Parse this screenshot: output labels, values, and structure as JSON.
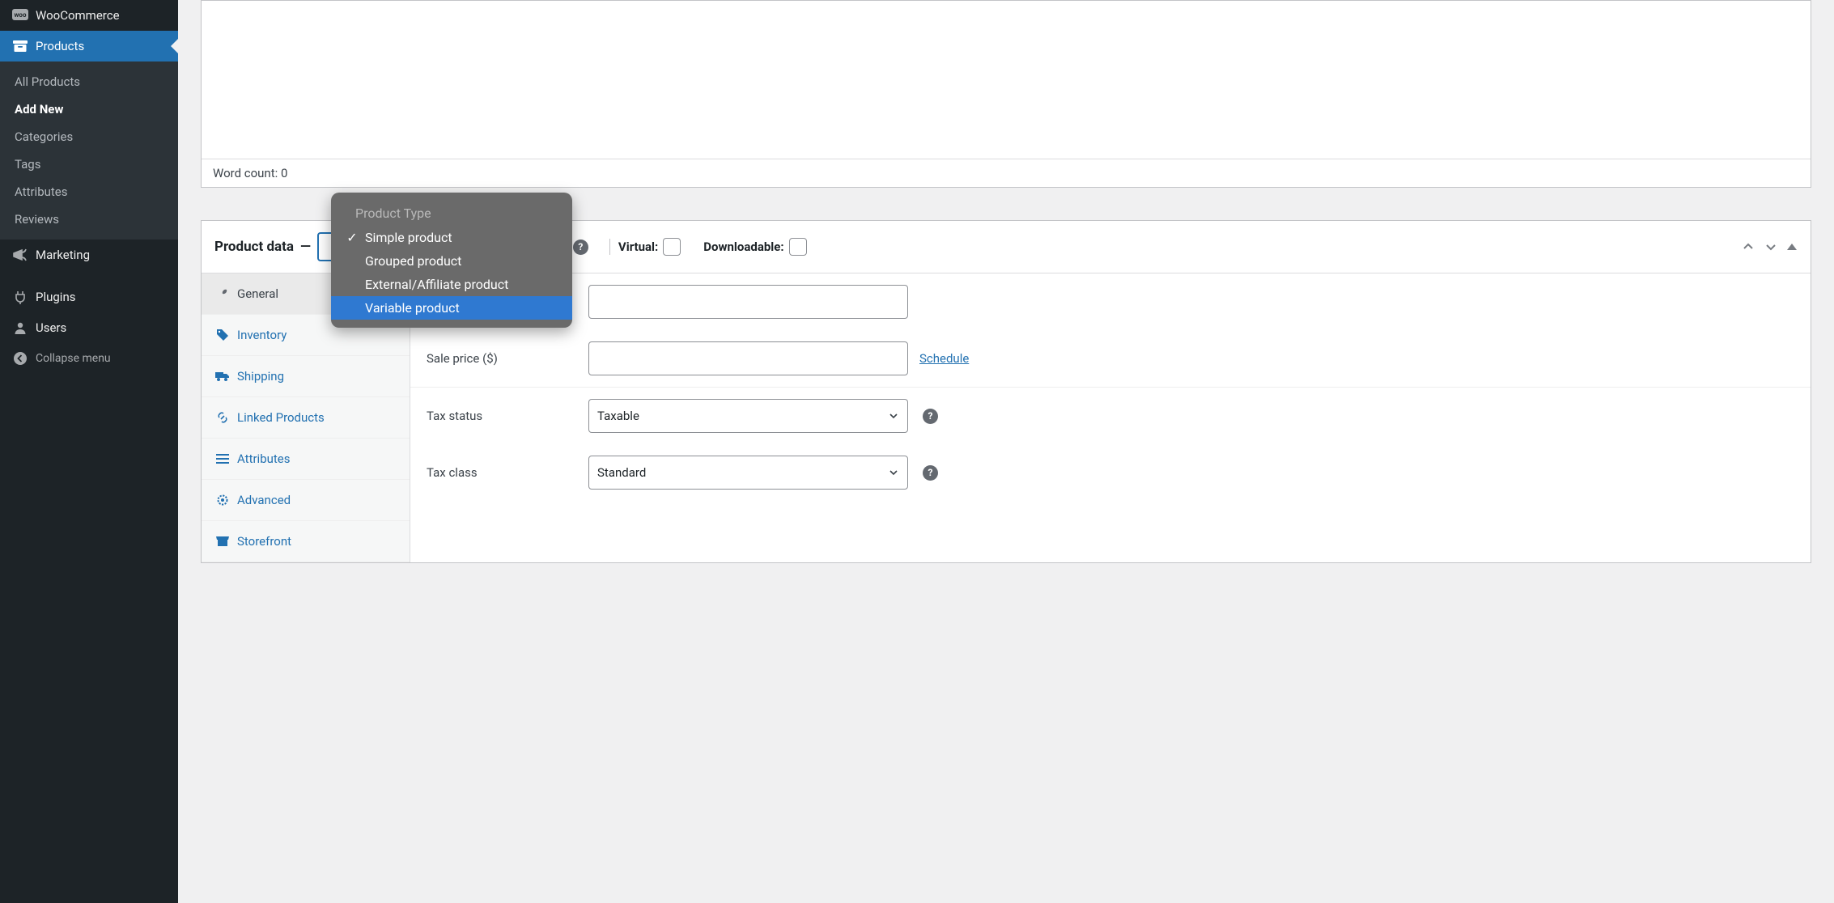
{
  "sidebar": {
    "woocommerce_label": "WooCommerce",
    "products_label": "Products",
    "submenu": [
      {
        "label": "All Products",
        "current": false
      },
      {
        "label": "Add New",
        "current": true
      },
      {
        "label": "Categories",
        "current": false
      },
      {
        "label": "Tags",
        "current": false
      },
      {
        "label": "Attributes",
        "current": false
      },
      {
        "label": "Reviews",
        "current": false
      }
    ],
    "marketing_label": "Marketing",
    "plugins_label": "Plugins",
    "users_label": "Users",
    "collapse_label": "Collapse menu"
  },
  "editor": {
    "word_count_label": "Word count: 0"
  },
  "panel": {
    "title": "Product data",
    "virtual_label": "Virtual:",
    "downloadable_label": "Downloadable:"
  },
  "dropdown": {
    "heading": "Product Type",
    "items": [
      {
        "label": "Simple product",
        "selected": true,
        "highlight": false
      },
      {
        "label": "Grouped product",
        "selected": false,
        "highlight": false
      },
      {
        "label": "External/Affiliate product",
        "selected": false,
        "highlight": false
      },
      {
        "label": "Variable product",
        "selected": false,
        "highlight": true
      }
    ]
  },
  "tabs": [
    {
      "label": "General",
      "active": true
    },
    {
      "label": "Inventory",
      "active": false
    },
    {
      "label": "Shipping",
      "active": false
    },
    {
      "label": "Linked Products",
      "active": false
    },
    {
      "label": "Attributes",
      "active": false
    },
    {
      "label": "Advanced",
      "active": false
    },
    {
      "label": "Storefront",
      "active": false
    }
  ],
  "fields": {
    "sale_price_label": "Sale price ($)",
    "schedule_link": "Schedule",
    "tax_status_label": "Tax status",
    "tax_status_value": "Taxable",
    "tax_class_label": "Tax class",
    "tax_class_value": "Standard"
  }
}
